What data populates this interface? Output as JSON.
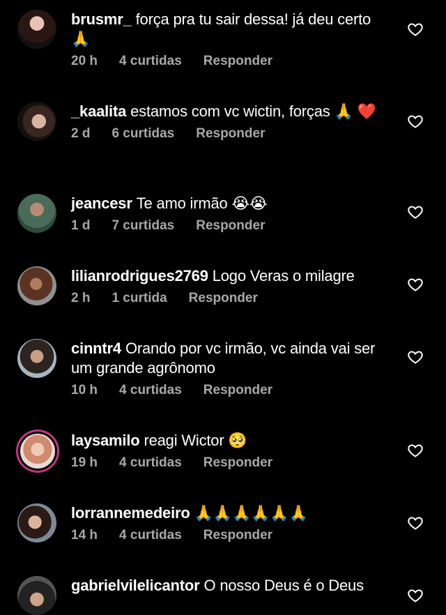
{
  "comments": [
    {
      "username": "brusmr_",
      "text": "força pra tu sair dessa! já deu certo 🙏",
      "time": "20 h",
      "likes": "4 curtidas",
      "reply": "Responder"
    },
    {
      "username": "_kaalita",
      "text": "estamos com vc wictin, forças 🙏 ❤️",
      "time": "2 d",
      "likes": "6 curtidas",
      "reply": "Responder"
    },
    {
      "username": "jeancesr",
      "text": "Te amo irmão 😭😭",
      "time": "1 d",
      "likes": "7 curtidas",
      "reply": "Responder"
    },
    {
      "username": "lilianrodrigues2769",
      "text": "Logo Veras o milagre",
      "time": "2 h",
      "likes": "1 curtida",
      "reply": "Responder"
    },
    {
      "username": "cinntr4",
      "text": "Orando por vc irmão, vc ainda vai ser um grande agrônomo",
      "time": "10 h",
      "likes": "4 curtidas",
      "reply": "Responder"
    },
    {
      "username": "laysamilo",
      "text": "reagi Wictor 🥺",
      "time": "19 h",
      "likes": "4 curtidas",
      "reply": "Responder"
    },
    {
      "username": "lorrannemedeiro",
      "text": "🙏🙏🙏🙏🙏🙏",
      "time": "14 h",
      "likes": "4 curtidas",
      "reply": "Responder"
    },
    {
      "username": "gabrielvilelicantor",
      "text": "O nosso Deus é o Deus",
      "time": "",
      "likes": "",
      "reply": ""
    }
  ],
  "icons": {
    "like": "heart-outline-icon"
  },
  "colors": {
    "background": "#000000",
    "text": "#ffffff",
    "meta": "#a8a8a8",
    "story_ring": "#c13584"
  }
}
